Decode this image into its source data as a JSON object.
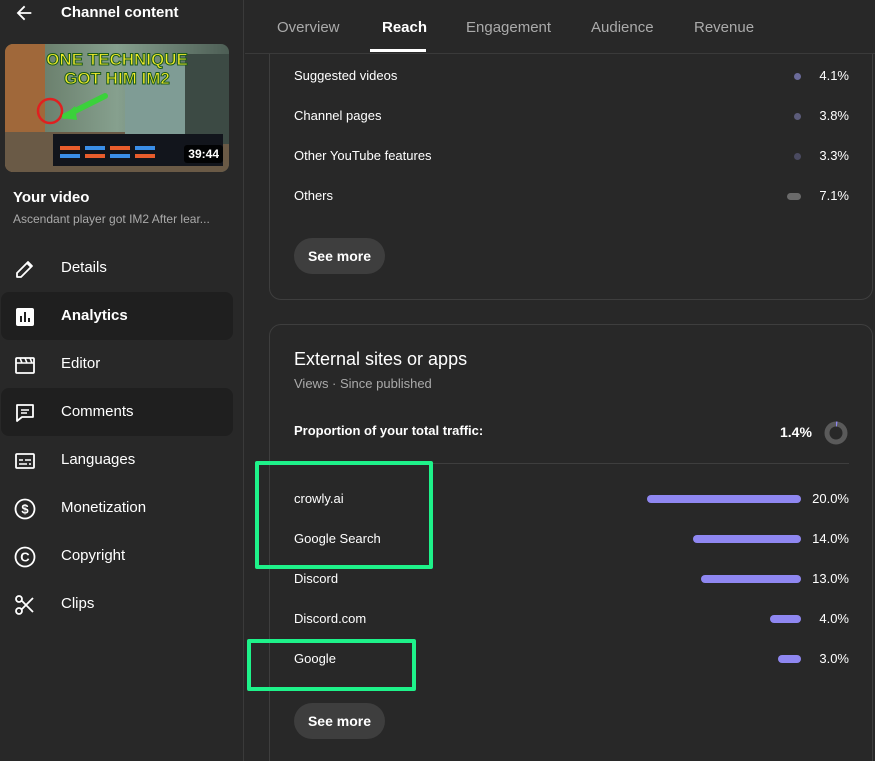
{
  "sidebar": {
    "title": "Channel content",
    "thumbnail": {
      "headline_line1": "ONE TECHNIQUE",
      "headline_line2": "GOT HIM IM2",
      "duration": "39:44"
    },
    "your_video_label": "Your video",
    "video_title": "Ascendant player got IM2 After lear...",
    "nav": [
      {
        "label": "Details",
        "icon": "pencil-icon"
      },
      {
        "label": "Analytics",
        "icon": "analytics-icon"
      },
      {
        "label": "Editor",
        "icon": "clapperboard-icon"
      },
      {
        "label": "Comments",
        "icon": "comment-icon"
      },
      {
        "label": "Languages",
        "icon": "subtitles-icon"
      },
      {
        "label": "Monetization",
        "icon": "dollar-icon"
      },
      {
        "label": "Copyright",
        "icon": "copyright-icon"
      },
      {
        "label": "Clips",
        "icon": "scissors-icon"
      }
    ],
    "active_item": "Analytics"
  },
  "tabs": [
    "Overview",
    "Reach",
    "Engagement",
    "Audience",
    "Revenue"
  ],
  "active_tab": "Reach",
  "traffic_sources": {
    "rows": [
      {
        "label": "Suggested videos",
        "percent": "4.1%",
        "value": 4.1
      },
      {
        "label": "Channel pages",
        "percent": "3.8%",
        "value": 3.8
      },
      {
        "label": "Other YouTube features",
        "percent": "3.3%",
        "value": 3.3
      },
      {
        "label": "Others",
        "percent": "7.1%",
        "value": 7.1
      }
    ],
    "see_more_label": "See more"
  },
  "external": {
    "title": "External sites or apps",
    "subtitle": "Views · Since published",
    "proportion_label": "Proportion of your total traffic:",
    "proportion_value": "1.4%",
    "rows": [
      {
        "label": "crowly.ai",
        "percent": "20.0%",
        "value": 20.0
      },
      {
        "label": "Google Search",
        "percent": "14.0%",
        "value": 14.0
      },
      {
        "label": "Discord",
        "percent": "13.0%",
        "value": 13.0
      },
      {
        "label": "Discord.com",
        "percent": "4.0%",
        "value": 4.0
      },
      {
        "label": "Google",
        "percent": "3.0%",
        "value": 3.0
      }
    ],
    "see_more_label": "See more"
  },
  "colors": {
    "bar": "#8f87f1",
    "highlight": "#1ef28a",
    "dot_dark": "#5c5c7a"
  }
}
